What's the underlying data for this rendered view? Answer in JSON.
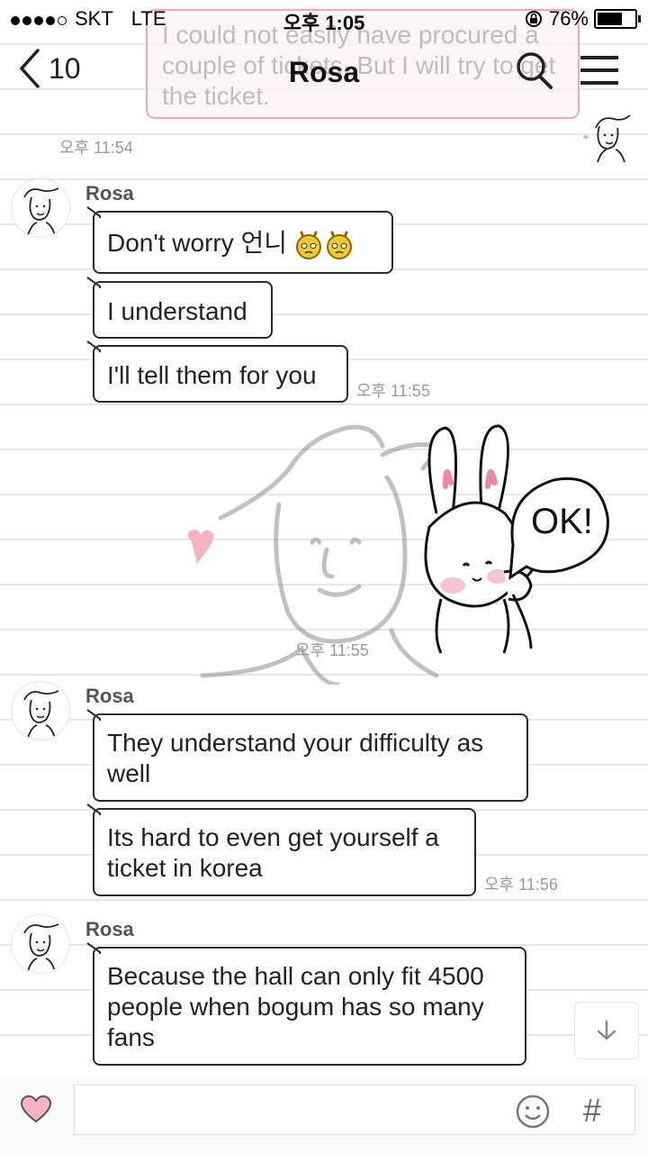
{
  "status_bar": {
    "carrier": "SKT",
    "network": "LTE",
    "time": "오후 1:05",
    "battery": "76%",
    "battery_level": 0.76
  },
  "header": {
    "back_count": "10",
    "title": "Rosa"
  },
  "previous_message": {
    "text": "I could not easily have procured a couple of tickets. But I will try to get the ticket.",
    "time": "오후 11:54"
  },
  "groups": [
    {
      "sender": "Rosa",
      "messages": [
        "Don't worry 언니",
        "I understand",
        "I'll tell them for you"
      ],
      "time": "오후 11:55"
    },
    {
      "sender": "Rosa",
      "messages": [
        "They understand your difficulty as well",
        "Its hard to even get yourself a ticket in korea"
      ],
      "time": "오후 11:56"
    },
    {
      "sender": "Rosa",
      "messages": [
        "Because the hall can only fit 4500 people when bogum has so many fans"
      ]
    }
  ],
  "sticker": {
    "text": "OK!",
    "time": "오후 11:55"
  },
  "input": {
    "placeholder": ""
  },
  "colors": {
    "accent_pink": "#f4a5b5",
    "bubble_border": "#2a2a2a",
    "timestamp": "#9a9a9a"
  },
  "icons": [
    "back-chevron-icon",
    "search-icon",
    "menu-icon",
    "heart-icon",
    "emoji-icon",
    "hash-icon",
    "arrow-down-icon"
  ]
}
